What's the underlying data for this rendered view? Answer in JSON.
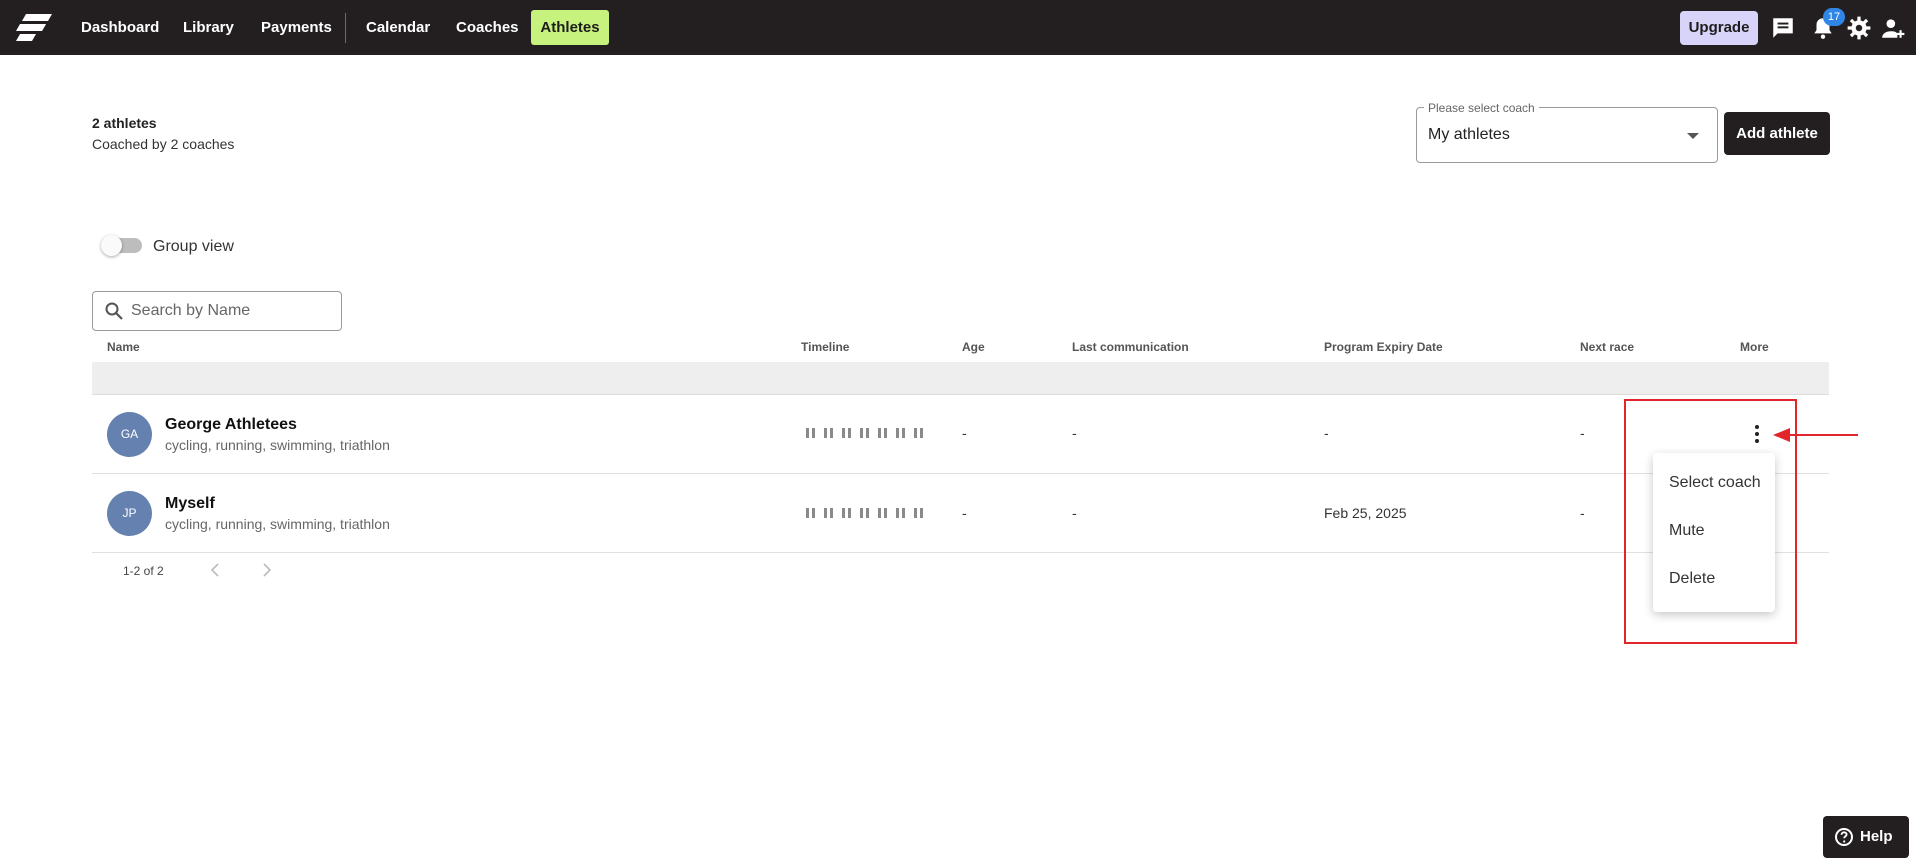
{
  "nav": {
    "items": [
      {
        "label": "Dashboard"
      },
      {
        "label": "Library"
      },
      {
        "label": "Payments"
      },
      {
        "label": "Calendar"
      },
      {
        "label": "Coaches"
      },
      {
        "label": "Athletes",
        "active": true
      }
    ],
    "upgrade_label": "Upgrade",
    "notification_count": "17",
    "icons": [
      "logo-icon",
      "chat-icon",
      "bell-icon",
      "gear-icon",
      "person-add-icon"
    ],
    "colors": {
      "bar": "#231f20",
      "active_tab": "#c8f27e",
      "upgrade": "#d8d3f8",
      "badge": "#2f86e6"
    }
  },
  "summary": {
    "count": "2 athletes",
    "coached_by": "Coached by 2 coaches"
  },
  "coach_select": {
    "label": "Please select coach",
    "value": "My athletes"
  },
  "add_athlete_label": "Add athlete",
  "group_view": {
    "label": "Group view",
    "enabled": false
  },
  "search": {
    "placeholder": "Search by Name"
  },
  "table": {
    "columns": [
      "Name",
      "Timeline",
      "Age",
      "Last communication",
      "Program Expiry Date",
      "Next race",
      "More"
    ],
    "rows": [
      {
        "initials": "GA",
        "name": "George Athletees",
        "sports": "cycling, running, swimming, triathlon",
        "age": "-",
        "last_communication": "-",
        "program_expiry": "-",
        "next_race": "-"
      },
      {
        "initials": "JP",
        "name": "Myself",
        "sports": "cycling, running, swimming, triathlon",
        "age": "-",
        "last_communication": "-",
        "program_expiry": "Feb 25, 2025",
        "next_race": "-"
      }
    ],
    "pagination": "1-2 of 2"
  },
  "more_menu": {
    "items": [
      "Select coach",
      "Mute",
      "Delete"
    ]
  },
  "annotation": {
    "color": "#e0262a"
  },
  "help_label": "Help"
}
